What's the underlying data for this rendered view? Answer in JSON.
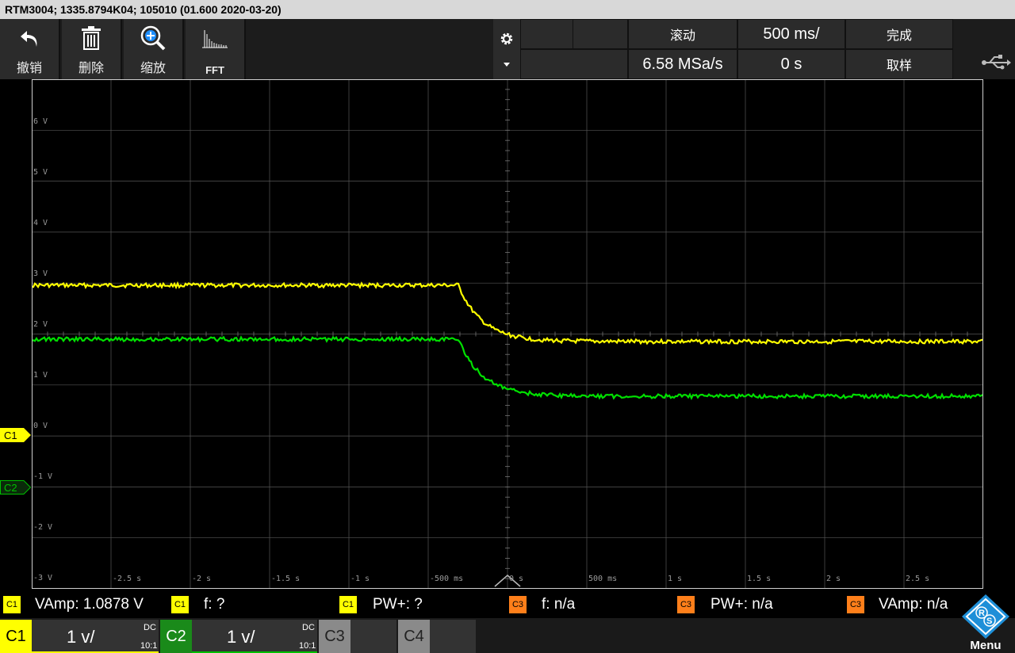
{
  "title": "RTM3004; 1335.8794K04; 105010 (01.600 2020-03-20)",
  "toolbar": {
    "undo_label": "撤销",
    "delete_label": "删除",
    "zoom_label": "缩放",
    "fft_label": "FFT"
  },
  "acquisition": {
    "mode": "滚动",
    "timebase": "500 ms/",
    "status": "完成",
    "sample_rate": "6.58 MSa/s",
    "position": "0 s",
    "acq_type": "取样"
  },
  "y_labels": [
    "6 V",
    "5 V",
    "4 V",
    "3 V",
    "2 V",
    "1 V",
    "0 V",
    "-1 V",
    "-2 V",
    "-3 V"
  ],
  "x_labels": [
    "-2.5 s",
    "-2 s",
    "-1.5 s",
    "-1 s",
    "-500 ms",
    "0 s",
    "500 ms",
    "1 s",
    "1.5 s",
    "2 s",
    "2.5 s"
  ],
  "markers": {
    "c1": "C1",
    "c2": "C2"
  },
  "measurements": [
    {
      "badge": "C1",
      "text": "VAmp: 1.0878 V"
    },
    {
      "badge": "C1",
      "text": "f: ?"
    },
    {
      "badge": "C1",
      "text": "PW+: ?"
    },
    {
      "badge": "C3",
      "text": "f: n/a"
    },
    {
      "badge": "C3",
      "text": "PW+: n/a"
    },
    {
      "badge": "C3",
      "text": "VAmp: n/a"
    }
  ],
  "channels": {
    "c1": {
      "label": "C1",
      "scale": "1 v/",
      "coupling": "DC",
      "probe": "10:1",
      "color": "#ffff00"
    },
    "c2": {
      "label": "C2",
      "scale": "1 v/",
      "coupling": "DC",
      "probe": "10:1",
      "color": "#00ff00"
    },
    "c3": {
      "label": "C3"
    },
    "c4": {
      "label": "C4"
    }
  },
  "menu_label": "Menu",
  "colors": {
    "ch1": "#ffff00",
    "ch2": "#00e000",
    "ch3": "#ff7f1a",
    "grid": "#555555"
  }
}
